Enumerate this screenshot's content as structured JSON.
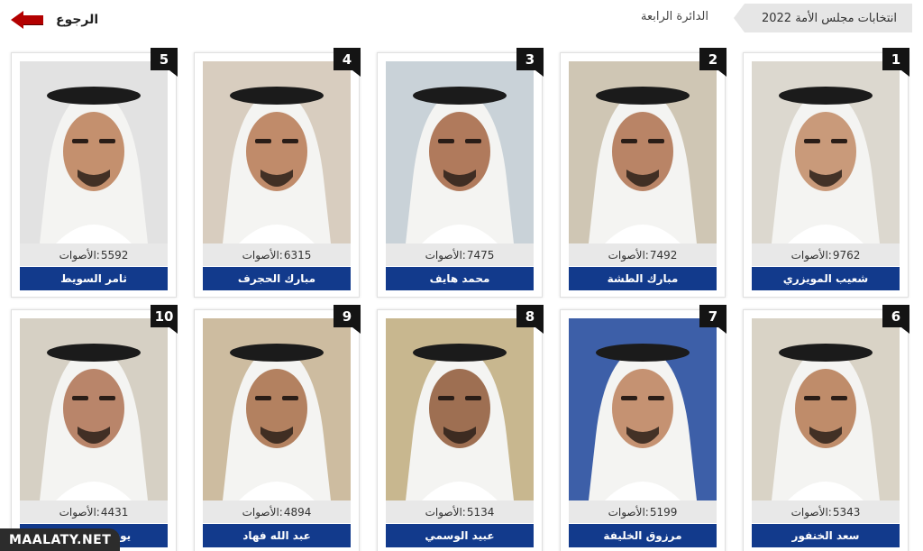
{
  "header": {
    "back_label": "الرجوع",
    "back_icon": "back-arrow-icon",
    "breadcrumb_main": "انتخابات مجلس الأمة 2022",
    "breadcrumb_sub": "الدائرة الرابعة"
  },
  "votes_prefix": "الأصوات:",
  "colors": {
    "name_bar": "#123a8c",
    "votes_bar": "#e8e8e8",
    "rank_badge": "#141414",
    "accent_arrow": "#b30000"
  },
  "candidates": [
    {
      "rank": "1",
      "votes": "9762",
      "name": "شعيب المويزري"
    },
    {
      "rank": "2",
      "votes": "7492",
      "name": "مبارك الطشة"
    },
    {
      "rank": "3",
      "votes": "7475",
      "name": "محمد هايف"
    },
    {
      "rank": "4",
      "votes": "6315",
      "name": "مبارك الحجرف"
    },
    {
      "rank": "5",
      "votes": "5592",
      "name": "ثامر السويط"
    },
    {
      "rank": "6",
      "votes": "5343",
      "name": "سعد الخنفور"
    },
    {
      "rank": "7",
      "votes": "5199",
      "name": "مرزوق الخليفة"
    },
    {
      "rank": "8",
      "votes": "5134",
      "name": "عبيد الوسمي"
    },
    {
      "rank": "9",
      "votes": "4894",
      "name": "عبد الله فهاد"
    },
    {
      "rank": "10",
      "votes": "4431",
      "name": "يوسف الغريب"
    }
  ],
  "watermark": "MAALATY.NET"
}
